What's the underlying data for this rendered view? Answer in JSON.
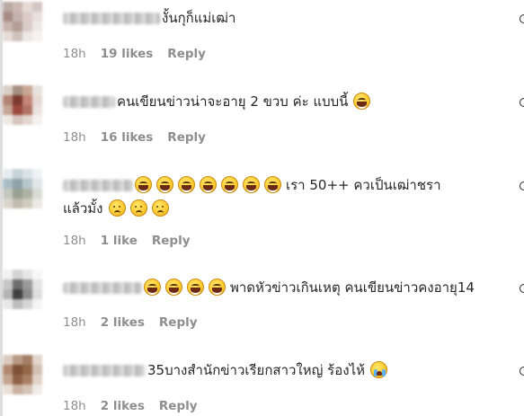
{
  "comments": [
    {
      "lines": [
        {
          "prefix_blur": true,
          "emojis_before": [],
          "text": "งั้นกุก็แม่เฒ่า",
          "emojis_after": []
        }
      ],
      "time": "18h",
      "likes": "19 likes",
      "reply": "Reply",
      "avatar_colors": [
        "#b9aaa4",
        "#cdb9b3",
        "#e4dbd6",
        "#d2c6c2",
        "#a78d86",
        "#c4b2ac",
        "#dccdc8",
        "#e9e1dd",
        "#c8b5ae",
        "#b49d95",
        "#d9cbc6",
        "#efe9e6",
        "#e5dcd8",
        "#d0c2bd",
        "#eee8e5",
        "#f6f2f0"
      ]
    },
    {
      "lines": [
        {
          "prefix_blur": true,
          "emojis_before": [],
          "text": "คนเขียนข่าวน่าจะอายุ 2 ขวบ ค่ะ แบบนี้",
          "emojis_after": [
            "laugh"
          ]
        }
      ],
      "time": "18h",
      "likes": "16 likes",
      "reply": "Reply",
      "avatar_colors": [
        "#d9cfc7",
        "#a58f80",
        "#c9a794",
        "#e8e2dd",
        "#b28474",
        "#7b3a30",
        "#c48676",
        "#e6d9d3",
        "#c5a596",
        "#9c4a3d",
        "#b27565",
        "#ebe2de",
        "#efe9e6",
        "#d6c4bd",
        "#e3d6d0",
        "#f5f1ef"
      ]
    },
    {
      "lines": [
        {
          "prefix_blur": true,
          "emojis_before": [
            "laugh",
            "laugh",
            "laugh",
            "laugh",
            "laugh",
            "laugh",
            "laugh"
          ],
          "text": "เรา 50++ ควเป็นเฒ่าชรา",
          "emojis_after": []
        },
        {
          "prefix_blur": false,
          "emojis_before": [],
          "text": "แล้วมั้ง",
          "emojis_after": [
            "sad",
            "sad",
            "sad"
          ]
        }
      ],
      "time": "18h",
      "likes": "1 like",
      "reply": "Reply",
      "avatar_colors": [
        "#e6ecef",
        "#c6d3d9",
        "#d9e2e6",
        "#eef2f4",
        "#a9bcc4",
        "#8ea3aa",
        "#b7c6cc",
        "#dfe6e9",
        "#c4c8bf",
        "#9a9f93",
        "#aeb2a5",
        "#d8dbd3",
        "#d8d5cb",
        "#bfbcae",
        "#cfccbf",
        "#ebe9e3"
      ]
    },
    {
      "lines": [
        {
          "prefix_blur": true,
          "emojis_before": [
            "laugh",
            "laugh",
            "laugh",
            "laugh"
          ],
          "text": "พาดหัวข่าวเกินเหตุ คนเขียนข่าวคงอายุ14",
          "emojis_after": []
        }
      ],
      "time": "18h",
      "likes": "2 likes",
      "reply": "Reply",
      "avatar_colors": [
        "#f1f1f1",
        "#d3d3d3",
        "#e6e6e6",
        "#f7f7f7",
        "#c7c7c7",
        "#6e6e6e",
        "#9a9a9a",
        "#e4e4e4",
        "#b5b5b5",
        "#3f3f3f",
        "#8c8c8c",
        "#dedede",
        "#e8e8e8",
        "#bcbcbc",
        "#d5d5d5",
        "#f4f4f4"
      ]
    },
    {
      "lines": [
        {
          "prefix_blur": true,
          "emojis_before": [],
          "text": "35บางสำนักข่าวเรียกสาวใหญ่ ร้องไห้",
          "emojis_after": [
            "cry"
          ]
        }
      ],
      "time": "18h",
      "likes": "2 likes",
      "reply": "Reply",
      "avatar_colors": [
        "#d9cbc0",
        "#b99a86",
        "#a47e66",
        "#e2d6cd",
        "#b08a70",
        "#7c5135",
        "#936749",
        "#d3c0b2",
        "#c2a48f",
        "#8e6246",
        "#a98065",
        "#e1d3c9",
        "#e9dfd8",
        "#c9b09f",
        "#d6c3b6",
        "#f1ebe6"
      ]
    }
  ]
}
